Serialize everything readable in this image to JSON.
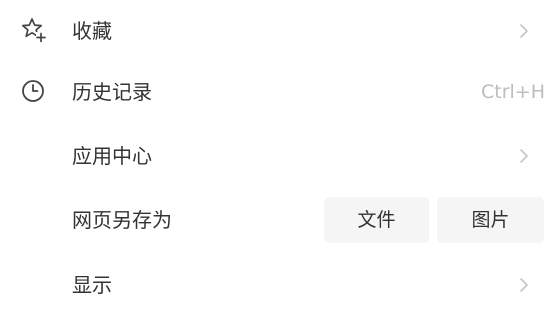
{
  "menu": {
    "items": [
      {
        "label": "收藏",
        "icon": "star-add-icon",
        "has_submenu": true
      },
      {
        "label": "历史记录",
        "icon": "clock-icon",
        "shortcut": "Ctrl+H"
      },
      {
        "label": "应用中心",
        "has_submenu": true
      },
      {
        "label": "网页另存为",
        "actions": [
          {
            "label": "文件"
          },
          {
            "label": "图片"
          }
        ]
      },
      {
        "label": "显示",
        "has_submenu": true
      }
    ]
  },
  "colors": {
    "background": "#ffffff",
    "text": "#333333",
    "muted": "#bdbdbd",
    "button_bg": "#f5f5f5",
    "chevron": "#c4c4c4"
  }
}
